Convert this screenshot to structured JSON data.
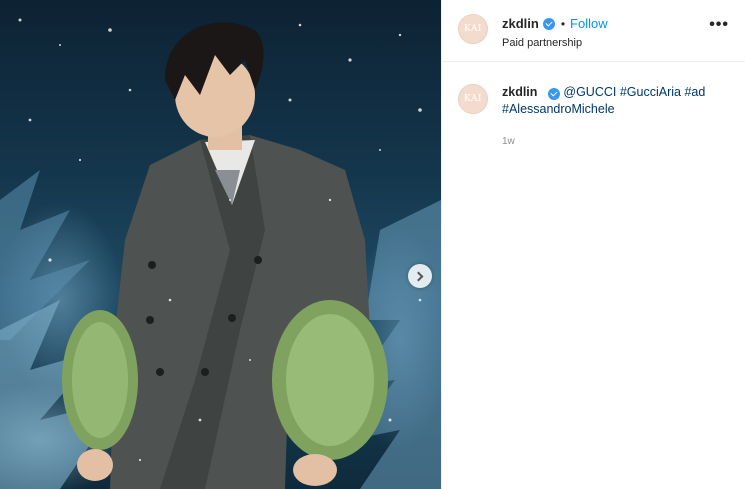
{
  "post": {
    "username": "zkdlin",
    "follow_label": "Follow",
    "dot": "•",
    "subtitle": "Paid partnership",
    "more_label": "•••",
    "avatar_text": "KAI",
    "caption": {
      "username": "zkdlin",
      "mention": "@GUCCI",
      "tags": [
        "#GucciAria",
        "#ad",
        "#AlessandroMichele"
      ]
    },
    "timestamp": "1w"
  },
  "icons": {
    "verified": "verified-badge-icon",
    "next": "chevron-right-icon",
    "more": "more-options-icon"
  },
  "colors": {
    "link_blue": "#0095f6",
    "hashtag": "#00376b",
    "verified": "#3897f0",
    "timestamp": "#8e8e8e"
  }
}
